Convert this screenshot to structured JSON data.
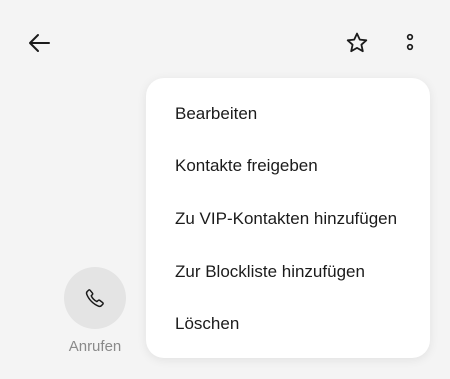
{
  "header": {
    "back_icon": "arrow-left-icon",
    "favorite_icon": "star-outline-icon",
    "more_icon": "more-vertical-icon"
  },
  "actions": {
    "call_label": "Anrufen",
    "call_icon": "phone-icon"
  },
  "menu": {
    "items": [
      {
        "label": "Bearbeiten"
      },
      {
        "label": "Kontakte freigeben"
      },
      {
        "label": "Zu VIP-Kontakten hinzufügen"
      },
      {
        "label": "Zur Blockliste hinzufügen"
      },
      {
        "label": "Löschen"
      }
    ]
  },
  "colors": {
    "background": "#f4f4f4",
    "menu_background": "#ffffff",
    "text": "#1b1b1b",
    "secondary_text": "#8a8a8a",
    "call_circle": "#e4e4e4"
  }
}
